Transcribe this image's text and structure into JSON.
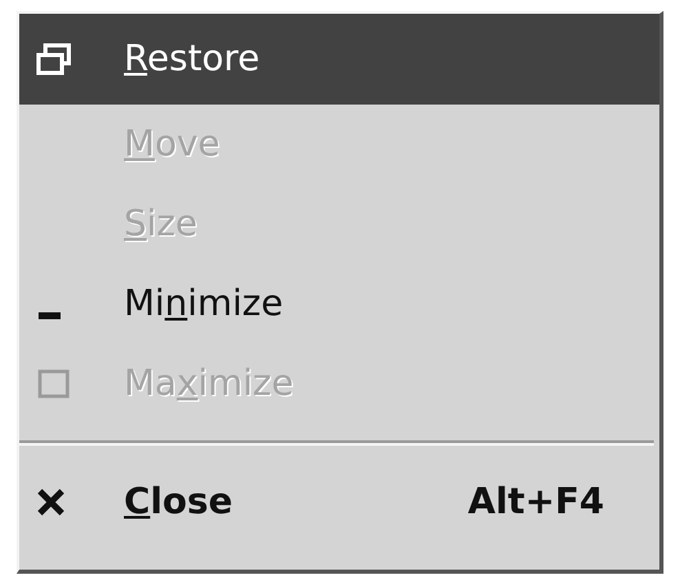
{
  "menu": {
    "items": [
      {
        "kind": "restore",
        "label": {
          "key": "R",
          "after": "estore"
        },
        "selected": true,
        "disabled": false,
        "default": false
      },
      {
        "kind": "plain",
        "label": {
          "key": "M",
          "after": "ove"
        },
        "selected": false,
        "disabled": true,
        "default": false
      },
      {
        "kind": "plain",
        "label": {
          "key": "S",
          "after": "ize"
        },
        "selected": false,
        "disabled": true,
        "default": false
      },
      {
        "kind": "minimize",
        "label": {
          "before": "Mi",
          "key": "n",
          "after": "imize"
        },
        "selected": false,
        "disabled": false,
        "default": false
      },
      {
        "kind": "maximize",
        "label": {
          "before": "Ma",
          "key": "x",
          "after": "imize"
        },
        "selected": false,
        "disabled": true,
        "default": false
      },
      {
        "kind": "separator"
      },
      {
        "kind": "close",
        "label": {
          "key": "C",
          "after": "lose"
        },
        "shortcut": "Alt+F4",
        "selected": false,
        "disabled": false,
        "default": true
      }
    ]
  }
}
